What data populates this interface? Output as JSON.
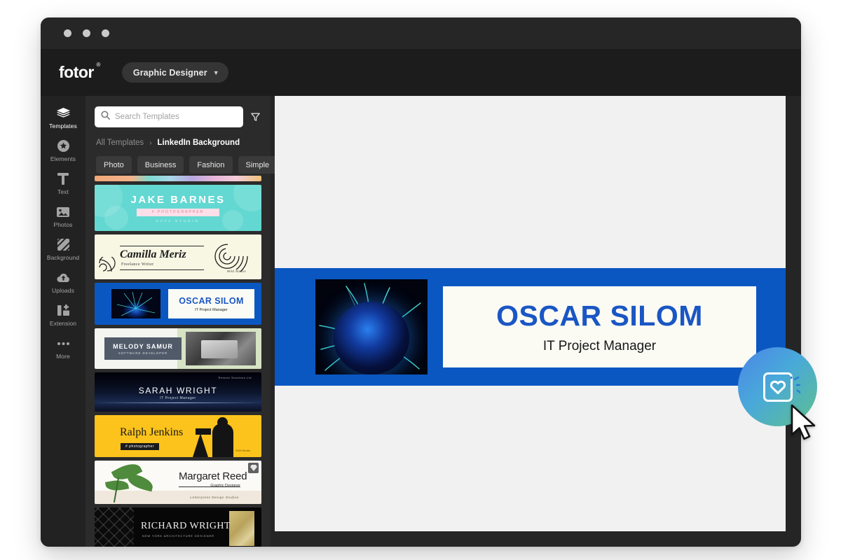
{
  "window": {
    "controls": [
      "close",
      "minimize",
      "maximize"
    ]
  },
  "brand": {
    "logo_text": "fotor",
    "logo_mark": "®",
    "role_label": "Graphic Designer",
    "role_chevron": "chevron-down-icon"
  },
  "rail": {
    "items": [
      {
        "label": "Templates",
        "icon": "layers-icon",
        "active": true
      },
      {
        "label": "Elements",
        "icon": "star-badge-icon",
        "active": false
      },
      {
        "label": "Text",
        "icon": "text-t-icon",
        "active": false
      },
      {
        "label": "Photos",
        "icon": "photo-icon",
        "active": false
      },
      {
        "label": "Background",
        "icon": "background-stripes-icon",
        "active": false
      },
      {
        "label": "Uploads",
        "icon": "cloud-upload-icon",
        "active": false
      },
      {
        "label": "Extension",
        "icon": "extension-icon",
        "active": false
      },
      {
        "label": "More",
        "icon": "ellipsis-icon",
        "active": false
      }
    ]
  },
  "panel": {
    "search": {
      "placeholder": "Search Templates",
      "value": "",
      "icon": "search-icon",
      "filter_icon": "filter-funnel-icon"
    },
    "breadcrumb": {
      "root": "All Templates",
      "separator": "›",
      "current": "LinkedIn Background"
    },
    "chips": [
      "Photo",
      "Business",
      "Fashion",
      "Simple"
    ],
    "templates": [
      {
        "id": "strip",
        "name": ""
      },
      {
        "id": "jake",
        "name": "JAKE BARNES",
        "role": "# PHOTOGRAPHER",
        "studio": "SAVA STUDIO"
      },
      {
        "id": "camilla",
        "name": "Camilla Meriz",
        "role": "Freelance Writer",
        "studio": "Wild Studio"
      },
      {
        "id": "oscar",
        "name": "OSCAR SILOM",
        "role": "IT Project Manager"
      },
      {
        "id": "melody",
        "name": "MELODY SAMUR",
        "role": "SOFTWARE DEVELOPER"
      },
      {
        "id": "sarah",
        "name": "SARAH WRIGHT",
        "role": "IT Project Manager",
        "top": "Remote Sessions Ltd"
      },
      {
        "id": "ralph",
        "name": "Ralph Jenkins",
        "role": "# photographer",
        "studio": "RJM Studio"
      },
      {
        "id": "margaret",
        "name": "Margaret Reed",
        "role": "Graphic Designer",
        "studio": "Letterpress Design Studios",
        "badge": "pro-diamond-icon"
      },
      {
        "id": "richard",
        "name": "RICHARD WRIGHT",
        "role": "NEW YORK ARCHITECTURE DESIGNER"
      }
    ]
  },
  "canvas": {
    "design": {
      "name": "OSCAR SILOM",
      "role": "IT Project Manager",
      "background_color": "#0b57c2",
      "card_color": "#fbfbf4",
      "name_color": "#1a56c4",
      "image": "plasma-ball-image"
    }
  },
  "fab": {
    "icon": "heart-in-square-icon",
    "cursor": "mouse-pointer-icon",
    "gradient_from": "#4a86e8",
    "gradient_to": "#5fc08d"
  }
}
